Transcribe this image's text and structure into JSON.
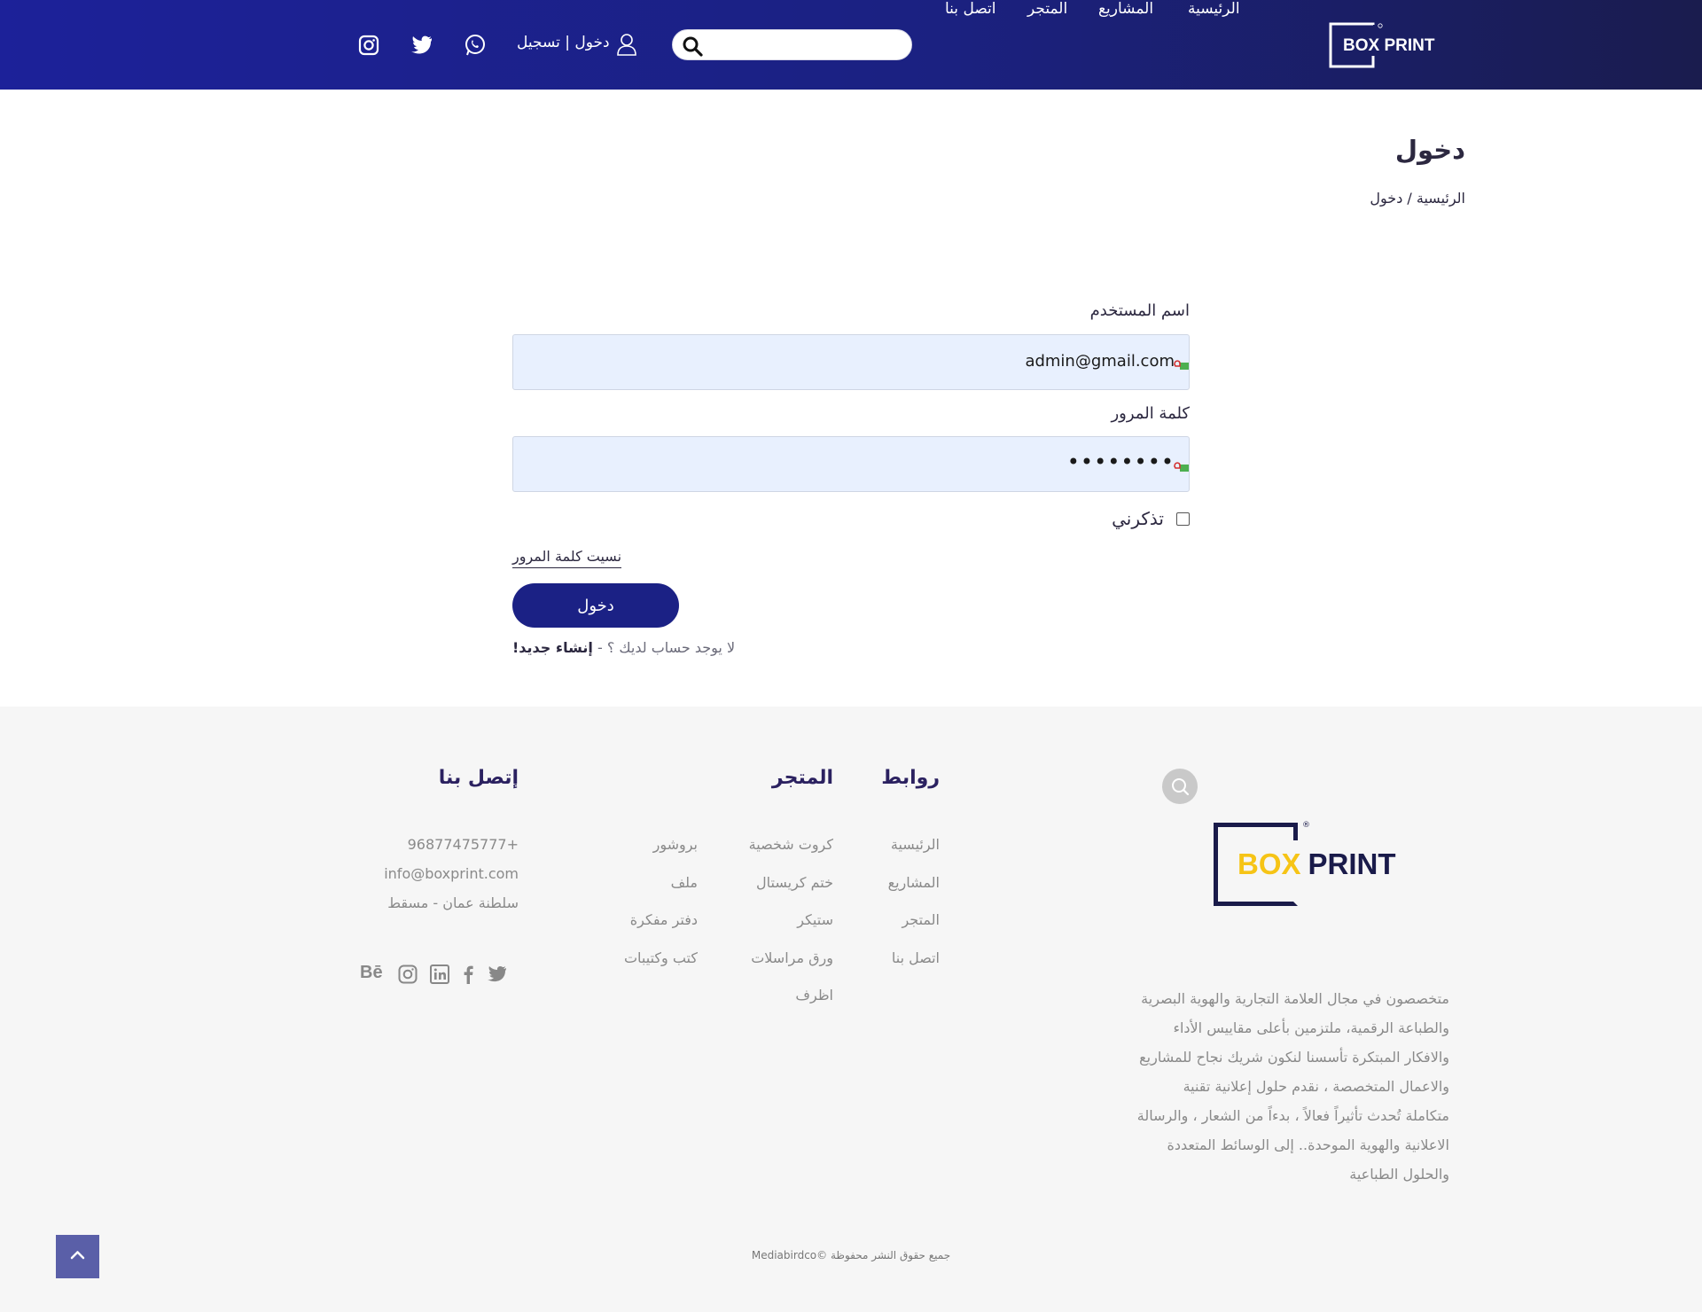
{
  "header": {
    "logo_text": "BOX PRINT",
    "nav": [
      "الرئيسية",
      "المشاريع",
      "المتجر",
      "اتصل بنا"
    ],
    "search": {
      "placeholder": "",
      "value": ""
    },
    "auth_link": "دخول | تسجيل",
    "social_icons": [
      "whatsapp-icon",
      "twitter-icon",
      "instagram-icon"
    ]
  },
  "page": {
    "title": "دخول",
    "breadcrumb": {
      "home": "الرئيسية",
      "separator": "/",
      "current": "دخول"
    }
  },
  "form": {
    "username_label": "اسم المستخدم",
    "username_value": "admin@gmail.com",
    "password_label": "كلمة المرور",
    "password_value": "••••••••",
    "remember_label": "تذكرني",
    "remember_checked": false,
    "forgot_link": "نسيت كلمة المرور",
    "submit_label": "دخول",
    "no_account_text": "لا يوجد حساب لديك ؟ -",
    "register_link": "إنشاء جديد!"
  },
  "footer": {
    "logo_box": "BOX",
    "logo_print": "PRINT",
    "about_lines": [
      "متخصصون في مجال العلامة التجارية والهوية البصرية",
      "والطباعة الرقمية، ملتزمين بأعلى مقاييس الأداء",
      "والافكار المبتكرة تأسسنا لنكون شريك نجاح للمشاريع",
      "والاعمال المتخصصة ، نقدم حلول إعلانية تقنية",
      "متكاملة تُحدث تأثيراً فعالاً ، بدءاً من الشعار ، والرسالة",
      "الاعلانية والهوية الموحدة.. إلى الوسائط المتعددة",
      "والحلول الطباعية"
    ],
    "links_title": "روابط",
    "links": [
      "الرئيسية",
      "المشاريع",
      "المتجر",
      "اتصل بنا"
    ],
    "store_title": "المتجر",
    "store_col1": [
      "كروت شخصية",
      "ختم كريستال",
      "ستيكر",
      "ورق مراسلات",
      "اظرف"
    ],
    "store_col2": [
      "بروشور",
      "ملف",
      "دفتر مفكرة",
      "كتب وكتيبات"
    ],
    "contact_title": "إتصل بنا",
    "contact": [
      "96877475777+",
      "info@boxprint.com",
      "سلطنة عمان - مسقط"
    ],
    "social_icons": [
      "twitter-icon",
      "facebook-icon",
      "linkedin-icon",
      "instagram-icon",
      "behance-icon"
    ],
    "behance_label": "Bē",
    "copyright": "جميع حقوق النشر محفوظة ©Mediabirdco"
  },
  "colors": {
    "header_start": "#1c2199",
    "header_end": "#1a1c4e",
    "button": "#1b2185",
    "input_bg": "#e8f0fe",
    "footer_bg": "#f6f6f6",
    "brand_yellow": "#f6c416",
    "brand_navy": "#1a1b4a"
  }
}
